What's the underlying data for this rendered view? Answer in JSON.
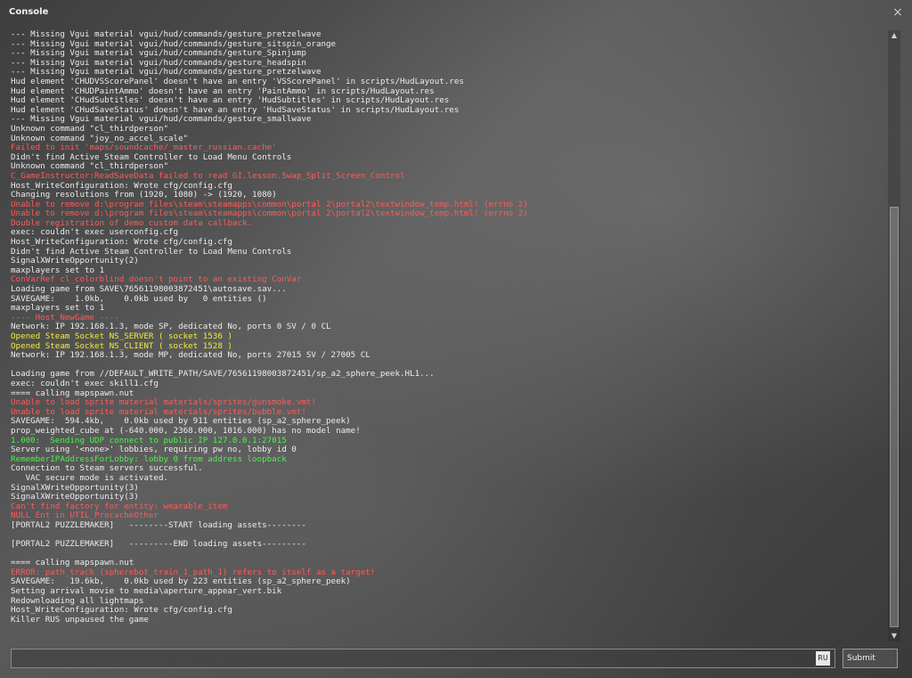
{
  "window": {
    "title": "Console",
    "close_icon": "×"
  },
  "log_lines": [
    {
      "text": "--- Missing Vgui material vgui/hud/commands/gesture_pretzelwave",
      "color": "white"
    },
    {
      "text": "--- Missing Vgui material vgui/hud/commands/gesture_sitspin_orange",
      "color": "white"
    },
    {
      "text": "--- Missing Vgui material vgui/hud/commands/gesture_Spinjump",
      "color": "white"
    },
    {
      "text": "--- Missing Vgui material vgui/hud/commands/gesture_headspin",
      "color": "white"
    },
    {
      "text": "--- Missing Vgui material vgui/hud/commands/gesture_pretzelwave",
      "color": "white"
    },
    {
      "text": "Hud element 'CHUDVSScorePanel' doesn't have an entry 'VSScorePanel' in scripts/HudLayout.res",
      "color": "white"
    },
    {
      "text": "Hud element 'CHUDPaintAmmo' doesn't have an entry 'PaintAmmo' in scripts/HudLayout.res",
      "color": "white"
    },
    {
      "text": "Hud element 'CHudSubtitles' doesn't have an entry 'HudSubtitles' in scripts/HudLayout.res",
      "color": "white"
    },
    {
      "text": "Hud element 'CHudSaveStatus' doesn't have an entry 'HudSaveStatus' in scripts/HudLayout.res",
      "color": "white"
    },
    {
      "text": "--- Missing Vgui material vgui/hud/commands/gesture_smallwave",
      "color": "white"
    },
    {
      "text": "Unknown command \"cl_thirdperson\"",
      "color": "white"
    },
    {
      "text": "Unknown command \"joy_no_accel_scale\"",
      "color": "white"
    },
    {
      "text": "Failed to init 'maps/soundcache/_master_russian.cache'",
      "color": "red"
    },
    {
      "text": "Didn't find Active Steam Controller to Load Menu Controls",
      "color": "white"
    },
    {
      "text": "Unknown command \"cl_thirdperson\"",
      "color": "white"
    },
    {
      "text": "C_GameInstructor:ReadSaveData failed to read GI.lesson.Swap_Split_Screen_Control",
      "color": "red"
    },
    {
      "text": "Host_WriteConfiguration: Wrote cfg/config.cfg",
      "color": "white"
    },
    {
      "text": "Changing resolutions from (1920, 1080) -> (1920, 1080)",
      "color": "white"
    },
    {
      "text": "Unable to remove d:\\program files\\steam\\steamapps\\common\\portal 2\\portal2\\textwindow_temp.html! (errno 2)",
      "color": "red"
    },
    {
      "text": "Unable to remove d:\\program files\\steam\\steamapps\\common\\portal 2\\portal2\\textwindow_temp.html! (errno 2)",
      "color": "red"
    },
    {
      "text": "Double registration of demo custom data callback.",
      "color": "red"
    },
    {
      "text": "exec: couldn't exec userconfig.cfg",
      "color": "white"
    },
    {
      "text": "Host_WriteConfiguration: Wrote cfg/config.cfg",
      "color": "white"
    },
    {
      "text": "Didn't find Active Steam Controller to Load Menu Controls",
      "color": "white"
    },
    {
      "text": "SignalXWriteOpportunity(2)",
      "color": "white"
    },
    {
      "text": "maxplayers set to 1",
      "color": "white"
    },
    {
      "text": "ConVarRef cl_colorblind doesn't point to an existing ConVar",
      "color": "red"
    },
    {
      "text": "Loading game from SAVE\\76561198003872451\\autosave.sav...",
      "color": "white"
    },
    {
      "text": "SAVEGAME:    1.0kb,    0.0kb used by   0 entities ()",
      "color": "white"
    },
    {
      "text": "maxplayers set to 1",
      "color": "white"
    },
    {
      "text": "---- Host_NewGame ----",
      "color": "red"
    },
    {
      "text": "Network: IP 192.168.1.3, mode SP, dedicated No, ports 0 SV / 0 CL",
      "color": "white"
    },
    {
      "text": "Opened Steam Socket NS_SERVER ( socket 1536 )",
      "color": "yellow"
    },
    {
      "text": "Opened Steam Socket NS_CLIENT ( socket 1528 )",
      "color": "yellow"
    },
    {
      "text": "Network: IP 192.168.1.3, mode MP, dedicated No, ports 27015 SV / 27005 CL",
      "color": "white"
    },
    {
      "text": "",
      "color": "white"
    },
    {
      "text": "Loading game from //DEFAULT_WRITE_PATH/SAVE/76561198003872451/sp_a2_sphere_peek.HL1...",
      "color": "white"
    },
    {
      "text": "exec: couldn't exec skill1.cfg",
      "color": "white"
    },
    {
      "text": "==== calling mapspawn.nut",
      "color": "white"
    },
    {
      "text": "Unable to load sprite material materials/sprites/gunsmoke.vmt!",
      "color": "red"
    },
    {
      "text": "Unable to load sprite material materials/sprites/bubble.vmt!",
      "color": "red"
    },
    {
      "text": "SAVEGAME:  594.4kb,    0.0kb used by 911 entities (sp_a2_sphere_peek)",
      "color": "white"
    },
    {
      "text": "prop_weighted_cube at (-640.000, 2368.000, 1016.000) has no model name!",
      "color": "white"
    },
    {
      "text": "1.000:  Sending UDP connect to public IP 127.0.0.1:27015",
      "color": "green"
    },
    {
      "text": "Server using '<none>' lobbies, requiring pw no, lobby id 0",
      "color": "white"
    },
    {
      "text": "RememberIPAddressForLobby: lobby 0 from address loopback",
      "color": "green"
    },
    {
      "text": "Connection to Steam servers successful.",
      "color": "white"
    },
    {
      "text": "   VAC secure mode is activated.",
      "color": "white"
    },
    {
      "text": "SignalXWriteOpportunity(3)",
      "color": "white"
    },
    {
      "text": "SignalXWriteOpportunity(3)",
      "color": "white"
    },
    {
      "text": "Can't find factory for entity: wearable_item",
      "color": "red"
    },
    {
      "text": "NULL Ent in UTIL_PrecacheOther",
      "color": "red"
    },
    {
      "text": "[PORTAL2 PUZZLEMAKER]   --------START loading assets--------",
      "color": "white"
    },
    {
      "text": "",
      "color": "white"
    },
    {
      "text": "[PORTAL2 PUZZLEMAKER]   ---------END loading assets---------",
      "color": "white"
    },
    {
      "text": "",
      "color": "white"
    },
    {
      "text": "==== calling mapspawn.nut",
      "color": "white"
    },
    {
      "text": "ERROR: path_track (spherebot_train_1_path_1) refers to itself as a target!",
      "color": "red"
    },
    {
      "text": "SAVEGAME:   19.6kb,    0.0kb used by 223 entities (sp_a2_sphere_peek)",
      "color": "white"
    },
    {
      "text": "Setting arrival movie to media\\aperture_appear_vert.bik",
      "color": "white"
    },
    {
      "text": "Redownloading all lightmaps",
      "color": "white"
    },
    {
      "text": "Host_WriteConfiguration: Wrote cfg/config.cfg",
      "color": "white"
    },
    {
      "text": "Killer RUS unpaused the game",
      "color": "white"
    }
  ],
  "input": {
    "value": "",
    "placeholder": "",
    "language_badge": "RU"
  },
  "submit_label": "Submit",
  "scrollbar": {
    "up_icon": "▲",
    "down_icon": "▼"
  },
  "colors": {
    "red": "#ff5a5a",
    "yellow": "#f2ec3a",
    "green": "#4cf24c",
    "white": "#ececec"
  }
}
